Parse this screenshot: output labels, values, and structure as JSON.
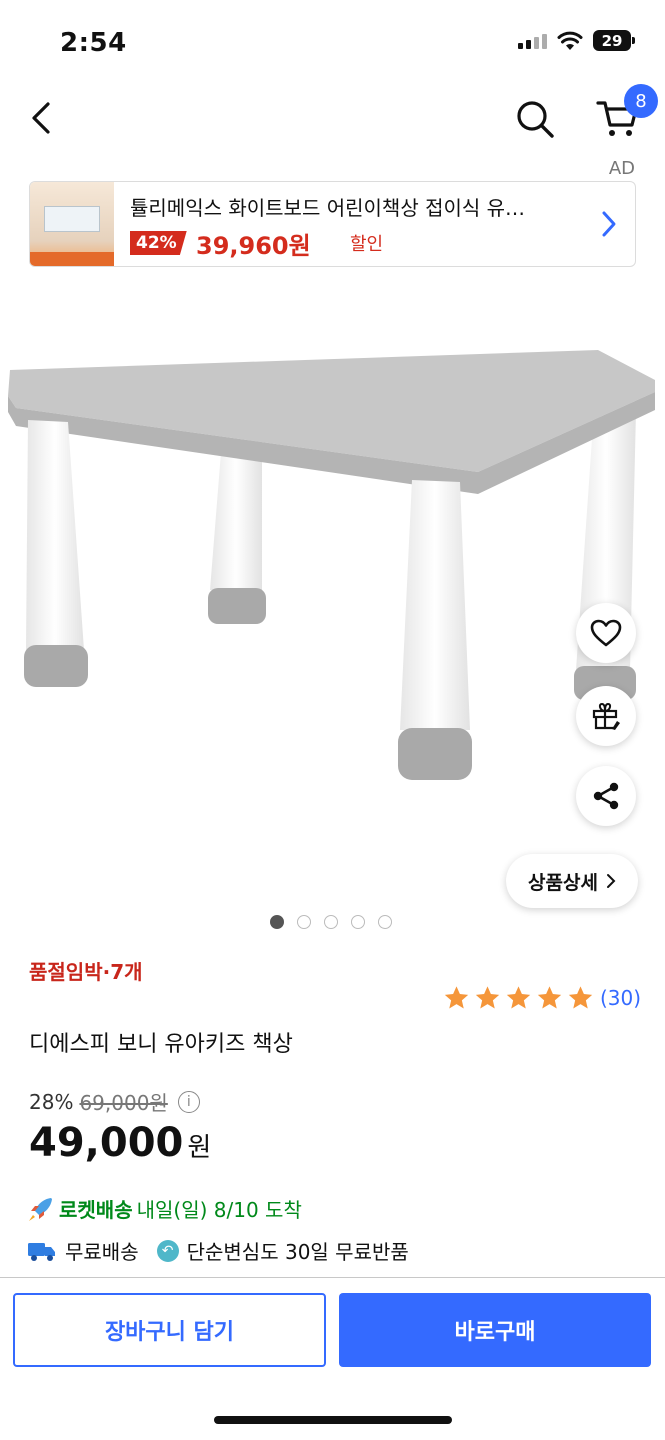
{
  "status_bar": {
    "time": "2:54",
    "battery": "29"
  },
  "nav": {
    "cart_count": "8",
    "ad_label": "AD"
  },
  "ad_banner": {
    "title": "튤리메익스 화이트보드 어린이책상 접이식 유…",
    "discount": "42%",
    "price": "39,960원",
    "sale_label": "할인"
  },
  "detail_button": "상품상세",
  "image_pager": {
    "count": 5,
    "active": 1
  },
  "product": {
    "stock_notice": "품절임박·7개",
    "rating": 5,
    "review_count": "(30)",
    "name": "디에스피 보니 유아키즈 책상",
    "discount_rate": "28%",
    "original_price": "69,000원",
    "price": "49,000",
    "price_unit": "원"
  },
  "delivery": {
    "rocket_label": "로켓배송",
    "arrival": "내일(일) 8/10 도착",
    "free_shipping": "무료배송",
    "return_policy": "단순변심도 30일 무료반품"
  },
  "actions": {
    "add_to_cart": "장바구니 담기",
    "buy_now": "바로구매"
  },
  "colors": {
    "accent": "#346aff",
    "sale_red": "#d42c1d",
    "rocket_green": "#00891a",
    "star": "#f5963a"
  }
}
